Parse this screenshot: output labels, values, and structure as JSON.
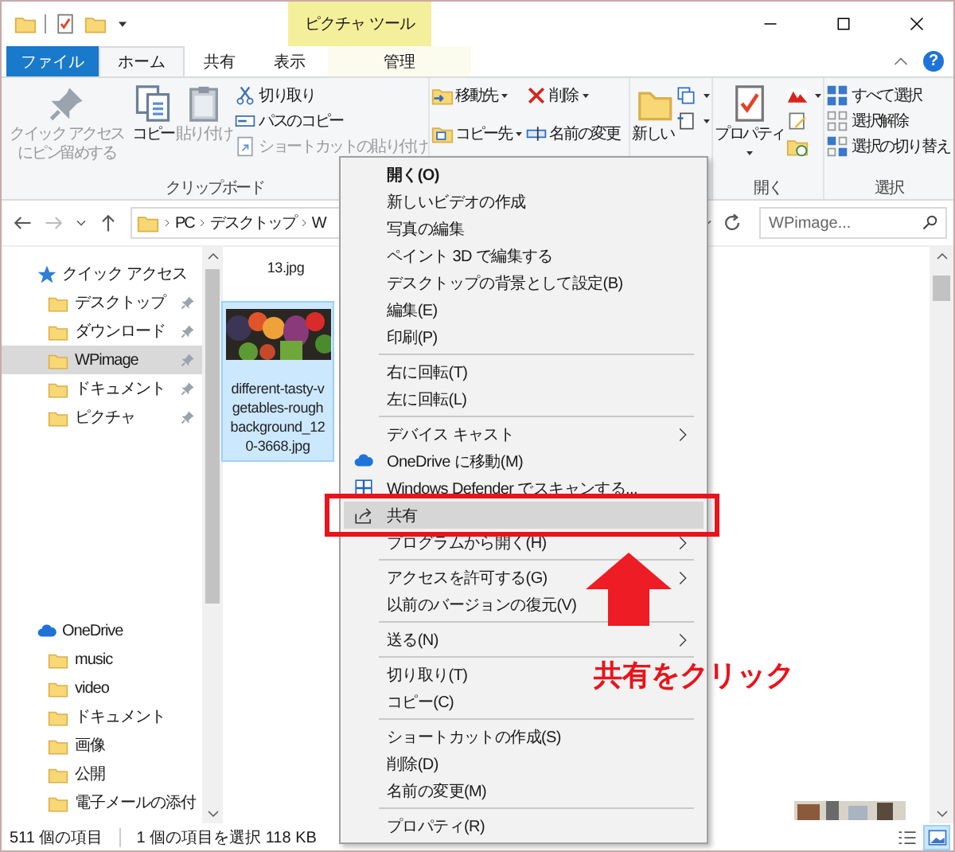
{
  "title_bar": {
    "contextual_tab": "ピクチャ ツール",
    "help": "?"
  },
  "tabs": [
    {
      "label": "ファイル",
      "kind": "file",
      "selected": false
    },
    {
      "label": "ホーム",
      "kind": "tab",
      "selected": true
    },
    {
      "label": "共有",
      "kind": "tab",
      "selected": false
    },
    {
      "label": "表示",
      "kind": "tab",
      "selected": false
    },
    {
      "label": "管理",
      "kind": "contextual",
      "selected": false
    }
  ],
  "ribbon": {
    "groups": [
      {
        "label": "クリップボード",
        "items": [
          {
            "label": "クイック アクセスにピン留めする",
            "kind": "large",
            "disabled": true
          },
          {
            "label": "コピー",
            "kind": "large",
            "disabled": false
          },
          {
            "label": "貼り付け",
            "kind": "large",
            "disabled": true
          },
          {
            "label": "切り取り",
            "kind": "small",
            "disabled": false
          },
          {
            "label": "パスのコピー",
            "kind": "small",
            "disabled": false
          },
          {
            "label": "ショートカットの貼り付け",
            "kind": "small",
            "disabled": true
          }
        ]
      },
      {
        "items": [
          {
            "label": "移動先",
            "kind": "small",
            "dropdown": true
          },
          {
            "label": "コピー先",
            "kind": "small",
            "dropdown": true
          },
          {
            "label": "削除",
            "kind": "small",
            "dropdown": true
          },
          {
            "label": "名前の変更",
            "kind": "small",
            "dropdown": false
          }
        ]
      },
      {
        "items": [
          {
            "label": "新しい",
            "kind": "large",
            "dropdown": false
          },
          {
            "kind": "icon",
            "dropdown": true
          },
          {
            "kind": "icon",
            "dropdown": true
          }
        ]
      },
      {
        "label": "開く",
        "items": [
          {
            "label": "プロパティ",
            "kind": "large",
            "dropdown": true
          },
          {
            "kind": "icon",
            "dropdown": true
          },
          {
            "kind": "icon",
            "dropdown": false
          },
          {
            "kind": "icon",
            "dropdown": false
          }
        ]
      },
      {
        "label": "選択",
        "items": [
          {
            "label": "すべて選択",
            "kind": "small",
            "disabled": false
          },
          {
            "label": "選択解除",
            "kind": "small",
            "disabled": false
          },
          {
            "label": "選択の切り替え",
            "kind": "small",
            "disabled": false
          }
        ]
      }
    ]
  },
  "address_bar": {
    "path": [
      "PC",
      "デスクトップ",
      "W"
    ],
    "search_placeholder": "WPimage..."
  },
  "navigation": [
    {
      "label": "クイック アクセス",
      "kind": "quick",
      "children": [
        {
          "label": "デスクトップ",
          "pinned": true,
          "selected": false
        },
        {
          "label": "ダウンロード",
          "pinned": true,
          "selected": false
        },
        {
          "label": "WPimage",
          "pinned": true,
          "selected": true
        },
        {
          "label": "ドキュメント",
          "pinned": true,
          "selected": false
        },
        {
          "label": "ピクチャ",
          "pinned": true,
          "selected": false
        }
      ]
    },
    {
      "label": "OneDrive",
      "kind": "cloud",
      "children": [
        {
          "label": "music",
          "pinned": false,
          "selected": false
        },
        {
          "label": "video",
          "pinned": false,
          "selected": false
        },
        {
          "label": "ドキュメント",
          "pinned": false,
          "selected": false
        },
        {
          "label": "画像",
          "pinned": false,
          "selected": false
        },
        {
          "label": "公開",
          "pinned": false,
          "selected": false
        },
        {
          "label": "電子メールの添付",
          "pinned": false,
          "selected": false
        }
      ]
    }
  ],
  "files": [
    {
      "name_lines": [
        "13.jpg"
      ],
      "kind": "name",
      "selected": false
    },
    {
      "name_lines": [
        "different-tasty-v",
        "getables-rough",
        "background_12",
        "0-3668.jpg"
      ],
      "kind": "picture",
      "selected": true
    }
  ],
  "status_bar": {
    "item_count": "511 個の項目",
    "selection": "1 個の項目を選択  118 KB"
  },
  "context_menu": [
    {
      "kind": "item",
      "label": "開く(O)",
      "default": true
    },
    {
      "kind": "item",
      "label": "新しいビデオの作成"
    },
    {
      "kind": "item",
      "label": "写真の編集"
    },
    {
      "kind": "item",
      "label": "ペイント 3D で編集する"
    },
    {
      "kind": "item",
      "label": "デスクトップの背景として設定(B)"
    },
    {
      "kind": "item",
      "label": "編集(E)"
    },
    {
      "kind": "item",
      "label": "印刷(P)"
    },
    {
      "kind": "separator"
    },
    {
      "kind": "item",
      "label": "右に回転(T)"
    },
    {
      "kind": "item",
      "label": "左に回転(L)"
    },
    {
      "kind": "separator"
    },
    {
      "kind": "item",
      "label": "デバイス キャスト",
      "submenu": true
    },
    {
      "kind": "item",
      "label": "OneDrive に移動(M)"
    },
    {
      "kind": "item",
      "label": "Windows Defender でスキャンする..."
    },
    {
      "kind": "item",
      "label": "共有",
      "highlighted": true
    },
    {
      "kind": "item",
      "label": "プログラムから開く(H)",
      "submenu": true
    },
    {
      "kind": "separator"
    },
    {
      "kind": "item",
      "label": "アクセスを許可する(G)",
      "submenu": true
    },
    {
      "kind": "item",
      "label": "以前のバージョンの復元(V)"
    },
    {
      "kind": "separator"
    },
    {
      "kind": "item",
      "label": "送る(N)",
      "submenu": true
    },
    {
      "kind": "separator"
    },
    {
      "kind": "item",
      "label": "切り取り(T)"
    },
    {
      "kind": "item",
      "label": "コピー(C)"
    },
    {
      "kind": "separator"
    },
    {
      "kind": "item",
      "label": "ショートカットの作成(S)"
    },
    {
      "kind": "item",
      "label": "削除(D)"
    },
    {
      "kind": "item",
      "label": "名前の変更(M)"
    },
    {
      "kind": "separator"
    },
    {
      "kind": "item",
      "label": "プロパティ(R)"
    }
  ],
  "annotation": {
    "text": "共有をクリック"
  }
}
